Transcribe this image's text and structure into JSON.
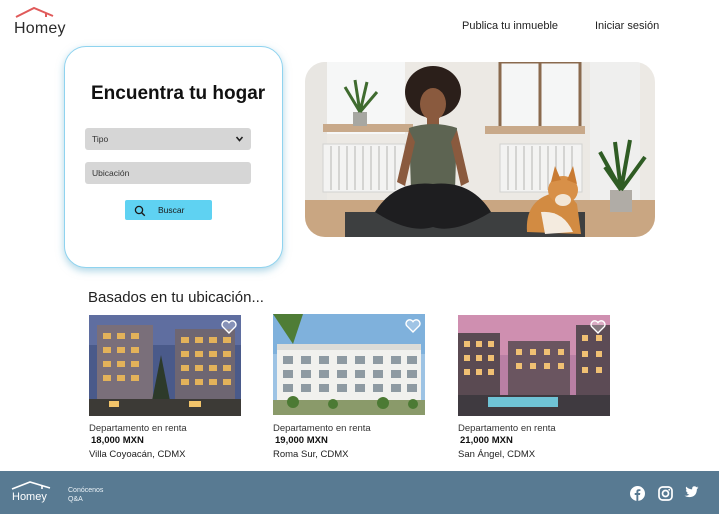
{
  "brand": {
    "name": "Homey",
    "accent": "#e05a5a",
    "primary": "#5fd2f2",
    "footer_color": "#587a92"
  },
  "header": {
    "nav": {
      "publish": "Publica tu inmueble",
      "login": "Iniciar sesión"
    }
  },
  "search": {
    "title": "Encuentra tu hogar",
    "type_select": "Tipo",
    "location_placeholder": "Ubicación",
    "button_label": "Buscar",
    "icon": "search-icon"
  },
  "hero": {
    "image": "woman-meditating-with-shiba-dog"
  },
  "section": {
    "title": "Basados en tu ubicación..."
  },
  "listings": [
    {
      "type": "Departamento en renta",
      "price": "18,000 MXN",
      "location": "Villa Coyoacán, CDMX",
      "favorite_icon": "heart-outline-icon"
    },
    {
      "type": "Departamento en renta",
      "price": "19,000 MXN",
      "location": "Roma Sur, CDMX",
      "favorite_icon": "heart-outline-icon"
    },
    {
      "type": "Departamento en renta",
      "price": "21,000 MXN",
      "location": "San Ángel, CDMX",
      "favorite_icon": "heart-outline-icon"
    }
  ],
  "footer": {
    "brand": "Homey",
    "links": [
      "Conócenos",
      "Q&A"
    ],
    "social": [
      "facebook-icon",
      "instagram-icon",
      "twitter-icon"
    ]
  }
}
